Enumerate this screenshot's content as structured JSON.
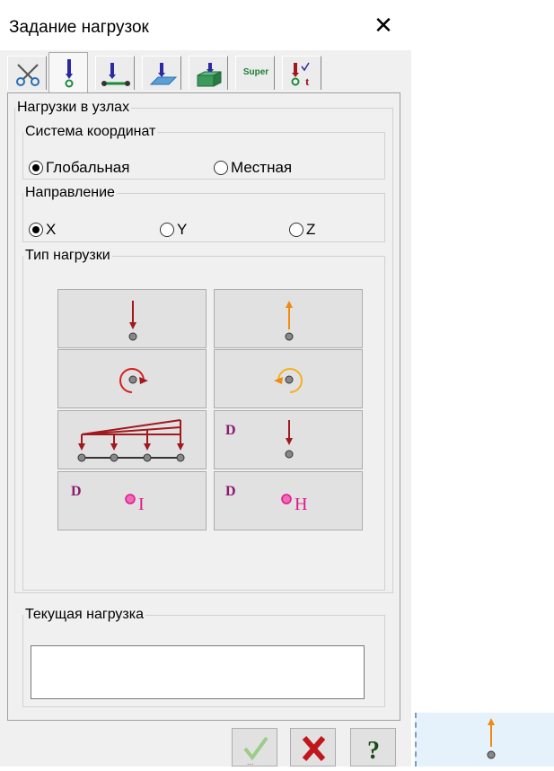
{
  "window": {
    "title": "Задание нагрузок",
    "close_icon": "close-icon"
  },
  "tabs": [
    {
      "icon": "scissors-icon"
    },
    {
      "icon": "node-load-icon",
      "active": true
    },
    {
      "icon": "bar-load-icon"
    },
    {
      "icon": "plate-load-icon"
    },
    {
      "icon": "solid-load-icon"
    },
    {
      "icon": "super-element-icon",
      "text": "Super"
    },
    {
      "icon": "time-load-icon"
    }
  ],
  "panel": {
    "title": "Нагрузки в узлах",
    "coord_system": {
      "title": "Система координат",
      "options": [
        "Глобальная",
        "Местная"
      ],
      "selected": "Глобальная"
    },
    "direction": {
      "title": "Направление",
      "options": [
        "X",
        "Y",
        "Z"
      ],
      "selected": "X"
    },
    "load_type": {
      "title": "Тип нагрузки",
      "buttons": [
        {
          "icon": "force-down-icon"
        },
        {
          "icon": "force-up-icon"
        },
        {
          "icon": "moment-cw-icon"
        },
        {
          "icon": "moment-ccw-icon"
        },
        {
          "icon": "distributed-load-icon"
        },
        {
          "icon": "dynamic-force-icon",
          "label": "D"
        },
        {
          "icon": "dynamic-i-icon",
          "label": "D",
          "sub": "I"
        },
        {
          "icon": "dynamic-h-icon",
          "label": "D",
          "sub": "H"
        }
      ]
    },
    "current_load": {
      "title": "Текущая нагрузка",
      "value": ""
    }
  },
  "footer": {
    "buttons": [
      {
        "icon": "apply-check-icon"
      },
      {
        "icon": "cancel-x-icon"
      },
      {
        "icon": "help-icon"
      }
    ]
  },
  "drag_preview": {
    "icon": "force-up-icon"
  },
  "colors": {
    "dark_red": "#a0191e",
    "orange": "#f08a10",
    "magenta": "#e0188c",
    "purple": "#8a1a70"
  }
}
